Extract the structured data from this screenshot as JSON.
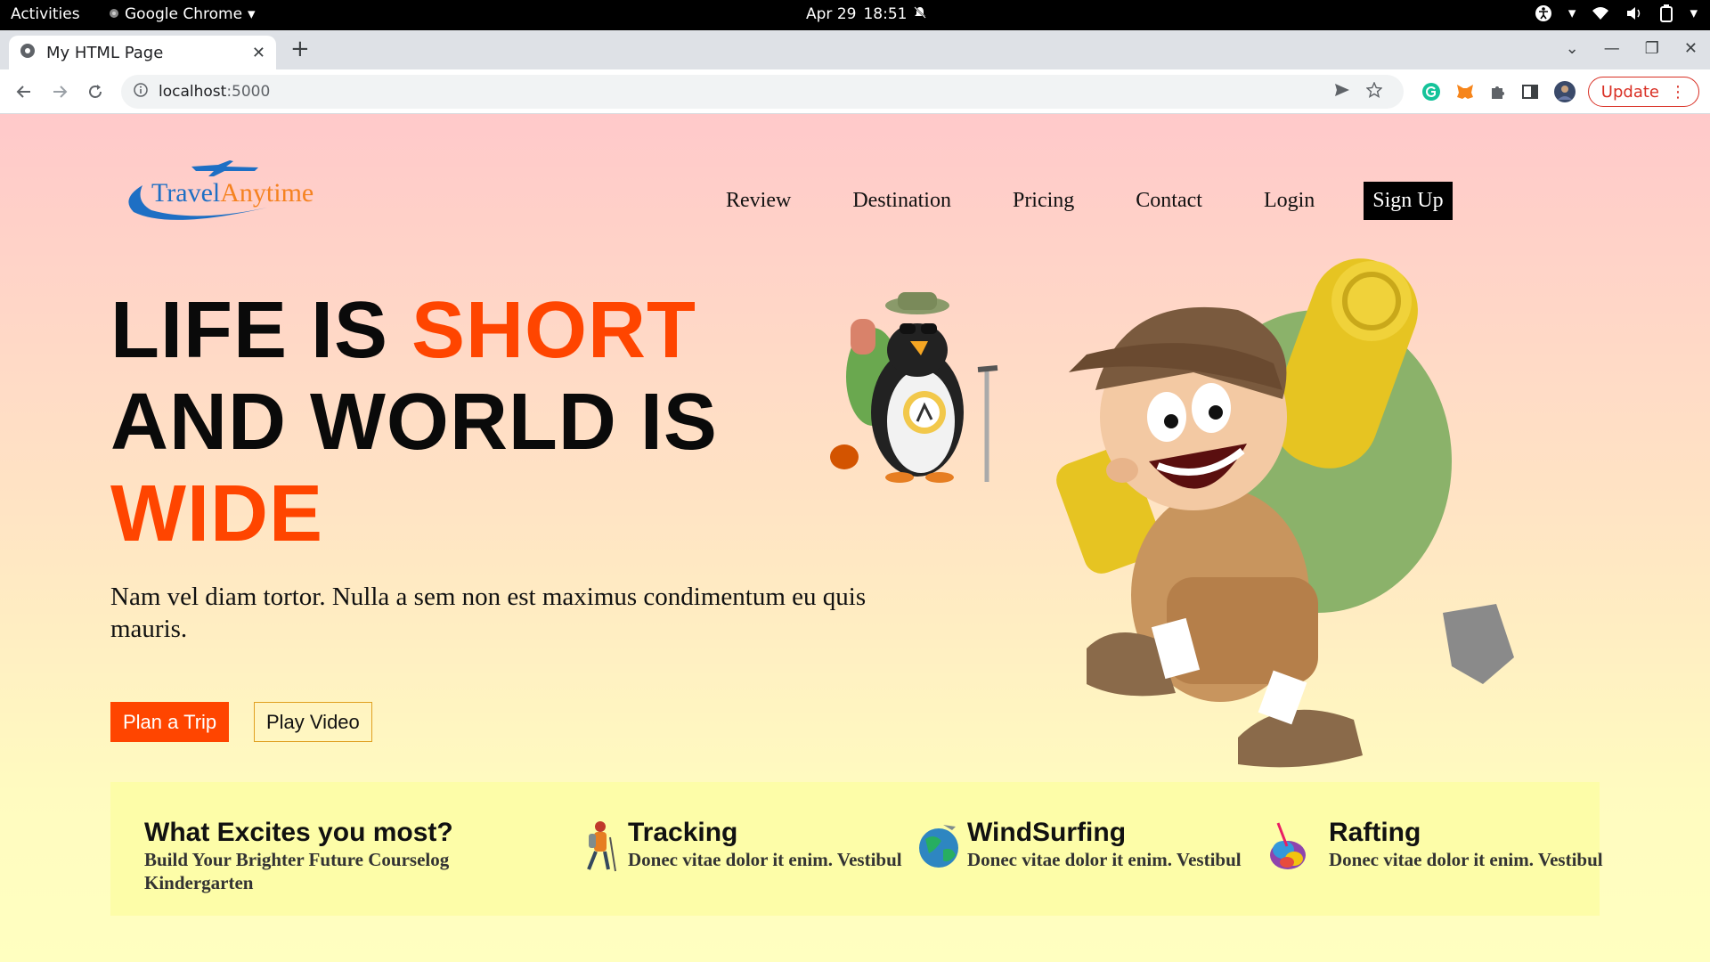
{
  "os": {
    "activities": "Activities",
    "app_name": "Google Chrome",
    "date": "Apr 29",
    "time": "18:51"
  },
  "browser": {
    "tab_title": "My HTML Page",
    "url_host": "localhost",
    "url_port": ":5000",
    "update_label": "Update"
  },
  "site": {
    "logo": {
      "word1": "Travel",
      "word2": "Anytime"
    },
    "nav": [
      "Review",
      "Destination",
      "Pricing",
      "Contact",
      "Login"
    ],
    "signup": "Sign Up",
    "hero": {
      "line1_a": "LIFE IS ",
      "line1_b": "SHORT",
      "line2": "AND WORLD IS",
      "line3": "WIDE",
      "subtitle": "Nam vel diam tortor. Nulla a sem non est maximus condimentum eu quis mauris.",
      "cta_primary": "Plan a Trip",
      "cta_secondary": "Play Video"
    },
    "features": {
      "intro_title": "What Excites you most?",
      "intro_text": "Build Your Brighter Future Courselog Kindergarten",
      "items": [
        {
          "title": "Tracking",
          "text": "Donec vitae dolor it enim. Vestibul",
          "icon": "hiker-icon"
        },
        {
          "title": "WindSurfing",
          "text": "Donec vitae dolor it enim. Vestibul",
          "icon": "globe-icon"
        },
        {
          "title": "Rafting",
          "text": "Donec vitae dolor it enim. Vestibul",
          "icon": "raft-icon"
        }
      ]
    }
  },
  "colors": {
    "accent": "#ff4500",
    "logo_blue": "#1e6fc4",
    "logo_orange": "#f58220"
  }
}
